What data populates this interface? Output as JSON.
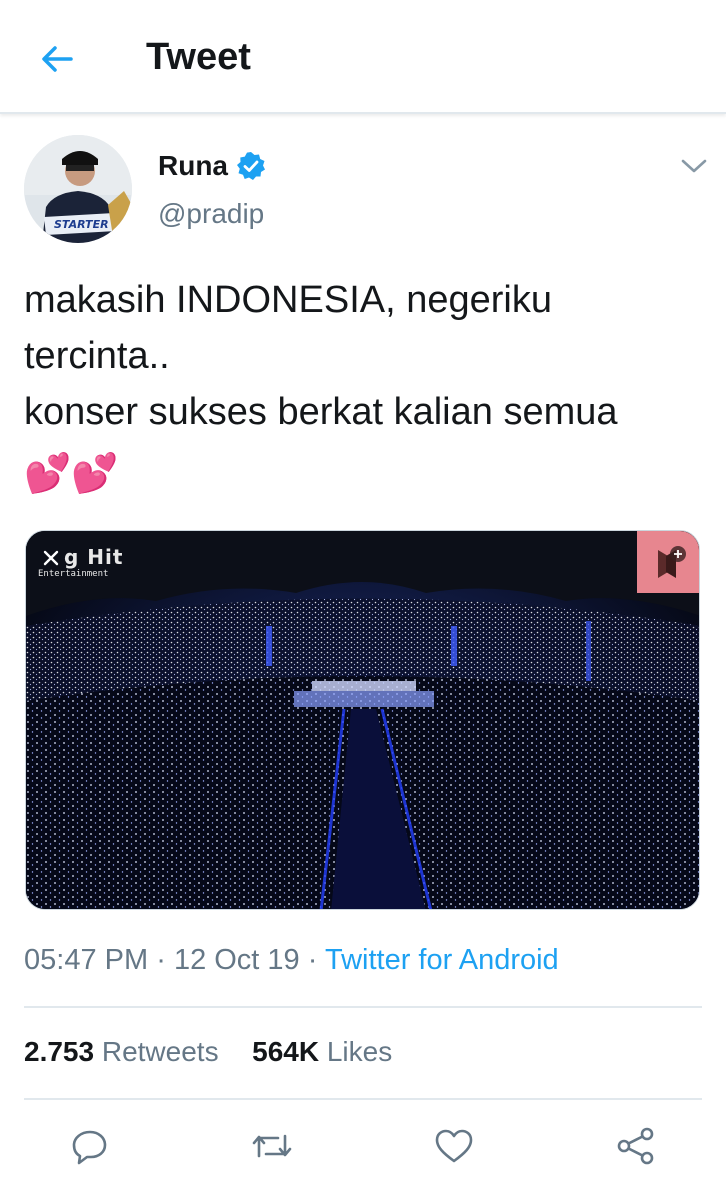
{
  "header": {
    "title": "Tweet",
    "back_icon": "arrow-left-icon",
    "accent_color": "#1da1f2"
  },
  "tweet": {
    "author": {
      "name": "Runa",
      "handle": "@pradip",
      "verified": true,
      "avatar_text": "STARTER"
    },
    "text": "makasih INDONESIA, negeriku tercinta..\nkonser sukses berkat kalian semua",
    "emoji": "💕💕",
    "media": {
      "watermark_line1": "g Hit",
      "watermark_line2": "Entertainment"
    },
    "time": "05:47 PM",
    "date": "12 Oct 19",
    "separator": "·",
    "source": "Twitter for Android"
  },
  "stats": {
    "retweets_count": "2.753",
    "retweets_label": "Retweets",
    "likes_count": "564K",
    "likes_label": "Likes"
  },
  "actions": [
    {
      "icon": "reply-icon"
    },
    {
      "icon": "retweet-icon"
    },
    {
      "icon": "like-icon"
    },
    {
      "icon": "share-icon"
    }
  ]
}
